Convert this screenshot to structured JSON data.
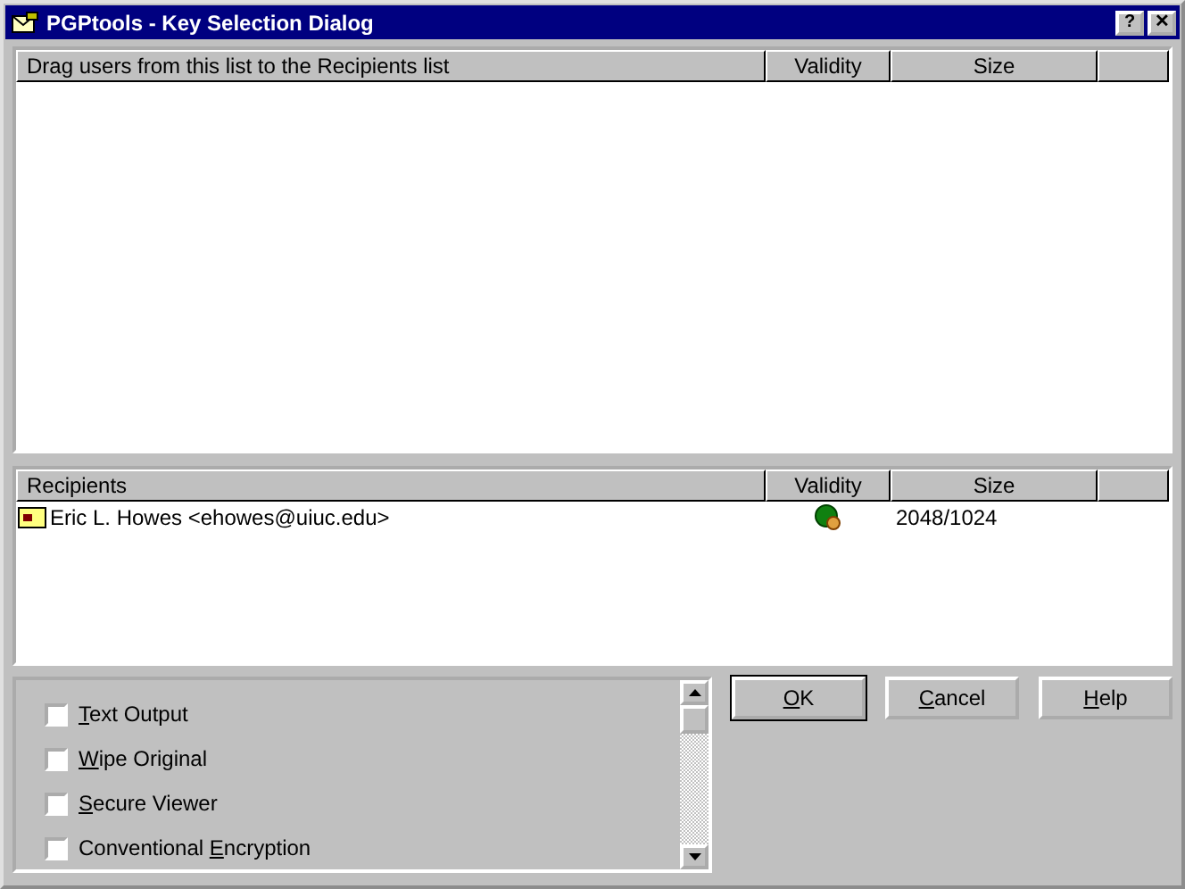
{
  "window": {
    "title": "PGPtools - Key Selection Dialog",
    "title_buttons": [
      "?",
      "✕"
    ]
  },
  "key_list": {
    "columns": [
      "Drag users from this list to the Recipients list",
      "Validity",
      "Size"
    ]
  },
  "recipients": {
    "columns": [
      "Recipients",
      "Validity",
      "Size"
    ],
    "rows": [
      {
        "name": "Eric L. Howes <ehowes@uiuc.edu>",
        "size": "2048/1024"
      }
    ]
  },
  "options": [
    {
      "mnemonic": "T",
      "label_after": "ext Output",
      "checked": false
    },
    {
      "mnemonic": "W",
      "label_after": "ipe Original",
      "checked": false
    },
    {
      "mnemonic": "S",
      "label_after": "ecure Viewer",
      "checked": false
    },
    {
      "label_before": "Conventional ",
      "mnemonic": "E",
      "label_after": "ncryption",
      "checked": false
    }
  ],
  "buttons": [
    {
      "mnemonic": "O",
      "label_after": "K",
      "default": true
    },
    {
      "mnemonic": "C",
      "label_after": "ancel",
      "default": false
    },
    {
      "mnemonic": "H",
      "label_after": "elp",
      "default": false
    }
  ]
}
